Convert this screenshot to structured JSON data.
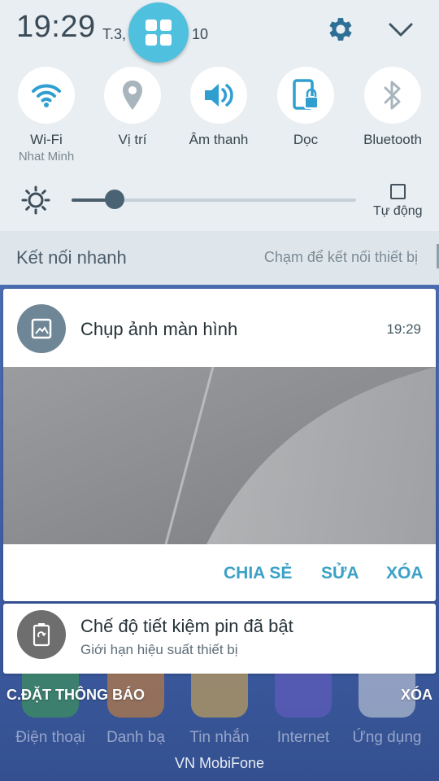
{
  "status": {
    "time": "19:29",
    "date_left": "T.3,",
    "date_right": "10"
  },
  "toggles": [
    {
      "label": "Wi-Fi",
      "sub": "Nhat Minh",
      "icon": "wifi-icon",
      "active": true
    },
    {
      "label": "Vị trí",
      "sub": "",
      "icon": "location-icon",
      "active": false
    },
    {
      "label": "Âm thanh",
      "sub": "",
      "icon": "sound-icon",
      "active": true
    },
    {
      "label": "Dọc",
      "sub": "",
      "icon": "rotation-lock-icon",
      "active": true
    },
    {
      "label": "Bluetooth",
      "sub": "",
      "icon": "bluetooth-icon",
      "active": false
    }
  ],
  "brightness": {
    "level": 0.15,
    "auto_label": "Tự động",
    "auto_checked": false
  },
  "quick_connect": {
    "title": "Kết nối nhanh",
    "hint": "Chạm để kết nối thiết bị"
  },
  "notification_screenshot": {
    "title": "Chụp ảnh màn hình",
    "time": "19:29",
    "icon": "image-icon",
    "actions": {
      "share": "CHIA SẺ",
      "edit": "SỬA",
      "delete": "XÓA"
    }
  },
  "notification_battery": {
    "title": "Chế độ tiết kiệm pin đã bật",
    "subtitle": "Giới hạn hiệu suất thiết bị",
    "icon": "battery-saver-icon"
  },
  "footer": {
    "settings_label": "C.ĐẶT THÔNG BÁO",
    "clear_label": "XÓA"
  },
  "dock": {
    "apps": [
      {
        "label": "Điện thoại",
        "color": "#3fa34d"
      },
      {
        "label": "Danh bạ",
        "color": "#e0872c"
      },
      {
        "label": "Tin nhắn",
        "color": "#e8b54a"
      },
      {
        "label": "Internet",
        "color": "#6c5dc7"
      },
      {
        "label": "Ứng dụng",
        "color": "#d9dde4"
      }
    ]
  },
  "carrier": "VN MobiFone",
  "colors": {
    "accent": "#3ba1c6",
    "panel_bg": "#e9eef2",
    "active_icon": "#2f9fd0",
    "inactive_icon": "#a9b5bd"
  }
}
